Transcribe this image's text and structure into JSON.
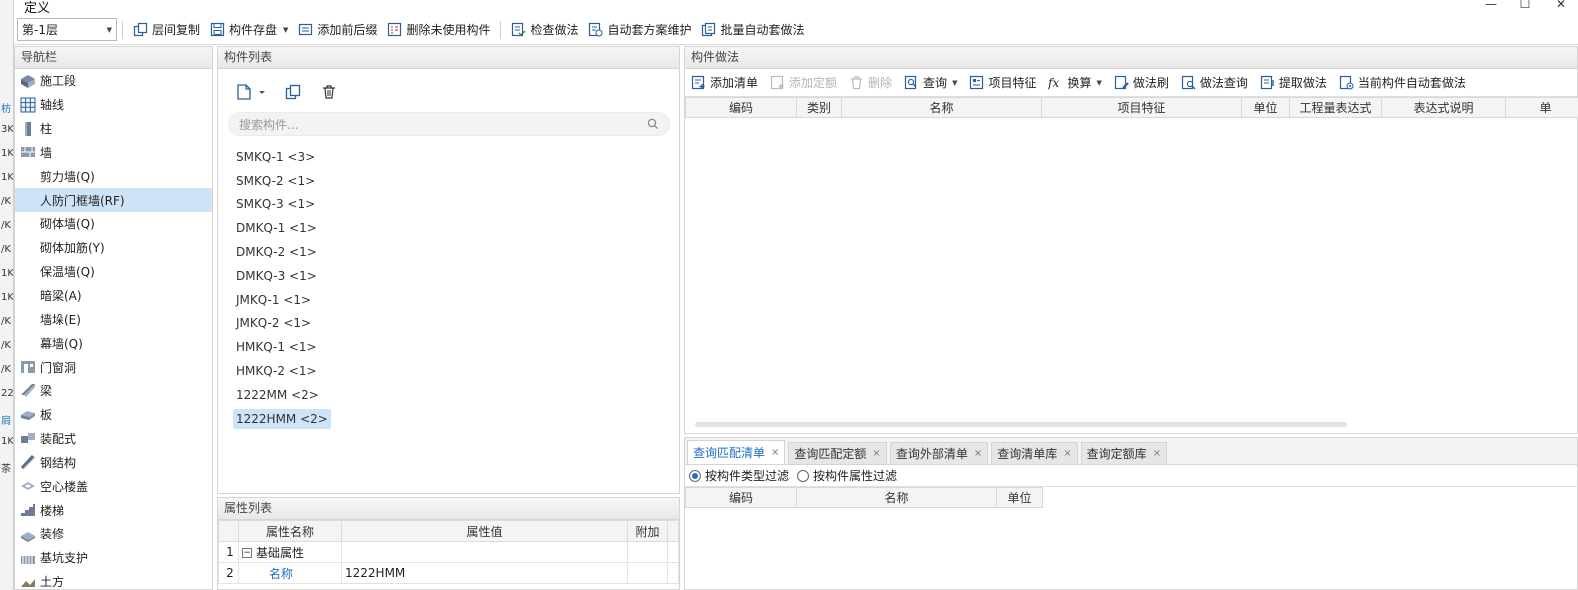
{
  "window": {
    "title": "定义",
    "minimize_glyph": "—",
    "maximize_glyph": "☐",
    "close_glyph": "✕"
  },
  "left_strip": {
    "fragments": [
      "枋",
      "3K",
      "1K",
      "1K",
      "/K",
      "/K",
      "/K",
      "1K",
      "1K",
      "/K",
      "/K",
      "/K",
      "22",
      "扃",
      "1K",
      "茶"
    ]
  },
  "toolbar": {
    "floor_select": "第-1层",
    "buttons": [
      {
        "label": "层间复制",
        "icon": "copy-floor-icon"
      },
      {
        "label": "构件存盘",
        "icon": "save-component-icon",
        "dropdown": true
      },
      {
        "label": "添加前后缀",
        "icon": "add-affix-icon"
      },
      {
        "label": "删除未使用构件",
        "icon": "delete-unused-icon"
      },
      {
        "label": "检查做法",
        "icon": "check-method-icon"
      },
      {
        "label": "自动套方案维护",
        "icon": "auto-scheme-icon"
      },
      {
        "label": "批量自动套做法",
        "icon": "batch-auto-icon"
      }
    ]
  },
  "nav": {
    "title": "导航栏",
    "items": [
      {
        "label": "施工段",
        "icon": "construction-section-icon",
        "sub": false,
        "selected": false
      },
      {
        "label": "轴线",
        "icon": "axis-grid-icon",
        "sub": false,
        "selected": false
      },
      {
        "label": "柱",
        "icon": "column-icon",
        "sub": false,
        "selected": false
      },
      {
        "label": "墙",
        "icon": "wall-icon",
        "sub": false,
        "selected": false
      },
      {
        "label": "剪力墙(Q)",
        "icon": "",
        "sub": true,
        "selected": false
      },
      {
        "label": "人防门框墙(RF)",
        "icon": "",
        "sub": true,
        "selected": true
      },
      {
        "label": "砌体墙(Q)",
        "icon": "",
        "sub": true,
        "selected": false
      },
      {
        "label": "砌体加筋(Y)",
        "icon": "",
        "sub": true,
        "selected": false
      },
      {
        "label": "保温墙(Q)",
        "icon": "",
        "sub": true,
        "selected": false
      },
      {
        "label": "暗梁(A)",
        "icon": "",
        "sub": true,
        "selected": false
      },
      {
        "label": "墙垛(E)",
        "icon": "",
        "sub": true,
        "selected": false
      },
      {
        "label": "幕墙(Q)",
        "icon": "",
        "sub": true,
        "selected": false
      },
      {
        "label": "门窗洞",
        "icon": "door-window-icon",
        "sub": false,
        "selected": false
      },
      {
        "label": "梁",
        "icon": "beam-icon",
        "sub": false,
        "selected": false
      },
      {
        "label": "板",
        "icon": "slab-icon",
        "sub": false,
        "selected": false
      },
      {
        "label": "装配式",
        "icon": "prefab-icon",
        "sub": false,
        "selected": false
      },
      {
        "label": "钢结构",
        "icon": "steel-structure-icon",
        "sub": false,
        "selected": false
      },
      {
        "label": "空心楼盖",
        "icon": "hollow-floor-icon",
        "sub": false,
        "selected": false
      },
      {
        "label": "楼梯",
        "icon": "stairs-icon",
        "sub": false,
        "selected": false
      },
      {
        "label": "装修",
        "icon": "decoration-icon",
        "sub": false,
        "selected": false
      },
      {
        "label": "基坑支护",
        "icon": "pit-support-icon",
        "sub": false,
        "selected": false
      },
      {
        "label": "土方",
        "icon": "earthwork-icon",
        "sub": false,
        "selected": false
      }
    ]
  },
  "component_list": {
    "title": "构件列表",
    "search_placeholder": "搜索构件...",
    "items": [
      {
        "label": "SMKQ-1 <3>",
        "selected": false
      },
      {
        "label": "SMKQ-2 <1>",
        "selected": false
      },
      {
        "label": "SMKQ-3 <1>",
        "selected": false
      },
      {
        "label": "DMKQ-1 <1>",
        "selected": false
      },
      {
        "label": "DMKQ-2 <1>",
        "selected": false
      },
      {
        "label": "DMKQ-3 <1>",
        "selected": false
      },
      {
        "label": "JMKQ-1 <1>",
        "selected": false
      },
      {
        "label": "JMKQ-2 <1>",
        "selected": false
      },
      {
        "label": "HMKQ-1 <1>",
        "selected": false
      },
      {
        "label": "HMKQ-2 <1>",
        "selected": false
      },
      {
        "label": "1222MM <2>",
        "selected": false
      },
      {
        "label": "1222HMM <2>",
        "selected": true
      }
    ]
  },
  "properties": {
    "title": "属性列表",
    "columns": [
      "属性名称",
      "属性值",
      "附加"
    ],
    "rows": [
      {
        "num": "1",
        "name": "基础属性",
        "value": "",
        "group": true
      },
      {
        "num": "2",
        "name": "名称",
        "value": "1222HMM",
        "group": false
      }
    ]
  },
  "method": {
    "title": "构件做法",
    "tools": [
      {
        "label": "添加清单",
        "icon": "add-list-icon",
        "disabled": false,
        "dropdown": false
      },
      {
        "label": "添加定额",
        "icon": "add-quota-icon",
        "disabled": true,
        "dropdown": false
      },
      {
        "label": "删除",
        "icon": "delete-icon",
        "disabled": true,
        "dropdown": false
      },
      {
        "label": "查询",
        "icon": "query-icon",
        "disabled": false,
        "dropdown": true
      },
      {
        "label": "项目特征",
        "icon": "project-feature-icon",
        "disabled": false,
        "dropdown": false
      },
      {
        "label": "换算",
        "icon": "fx-icon",
        "disabled": false,
        "dropdown": true
      },
      {
        "label": "做法刷",
        "icon": "method-brush-icon",
        "disabled": false,
        "dropdown": false
      },
      {
        "label": "做法查询",
        "icon": "method-query-icon",
        "disabled": false,
        "dropdown": false
      },
      {
        "label": "提取做法",
        "icon": "extract-method-icon",
        "disabled": false,
        "dropdown": false
      },
      {
        "label": "当前构件自动套做法",
        "icon": "auto-apply-icon",
        "disabled": false,
        "dropdown": false
      }
    ],
    "columns": [
      "编码",
      "类别",
      "名称",
      "项目特征",
      "单位",
      "工程量表达式",
      "表达式说明",
      "单"
    ]
  },
  "query": {
    "tabs": [
      {
        "label": "查询匹配清单",
        "active": true
      },
      {
        "label": "查询匹配定额",
        "active": false
      },
      {
        "label": "查询外部清单",
        "active": false
      },
      {
        "label": "查询清单库",
        "active": false
      },
      {
        "label": "查询定额库",
        "active": false
      }
    ],
    "close_glyph": "×",
    "filters": [
      {
        "label": "按构件类型过滤",
        "checked": true
      },
      {
        "label": "按构件属性过滤",
        "checked": false
      }
    ],
    "columns": [
      "编码",
      "名称",
      "单位"
    ]
  },
  "colors": {
    "accent": "#1f6fc4",
    "selection": "#cfe3f8"
  }
}
